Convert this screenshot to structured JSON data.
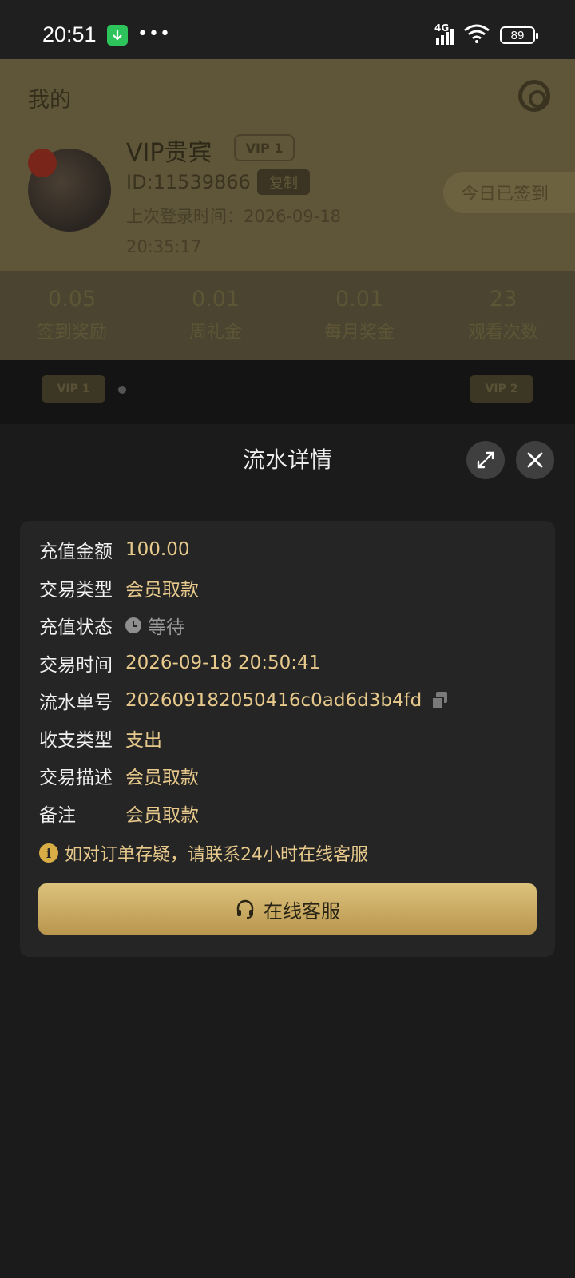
{
  "status_bar": {
    "time": "20:51",
    "network": "4G",
    "battery": "89"
  },
  "background": {
    "title": "我的",
    "username": "VIP贵宾",
    "vip_badge": "VIP 1",
    "user_id": "ID:11539866",
    "copy_tag": "复制",
    "last_login_label": "上次登录时间：",
    "last_login_value": "2026-09-18 20:35:17",
    "checkin_label": "今日已签到",
    "stats": [
      {
        "value": "0.05",
        "label": "签到奖励"
      },
      {
        "value": "0.01",
        "label": "周礼金"
      },
      {
        "value": "0.01",
        "label": "每月奖金"
      },
      {
        "value": "23",
        "label": "观看次数"
      }
    ],
    "vip_level_current": "VIP 1",
    "vip_level_next": "VIP 2"
  },
  "sheet": {
    "title": "流水详情",
    "rows": [
      {
        "label": "充值金额",
        "value": "100.00"
      },
      {
        "label": "交易类型",
        "value": "会员取款"
      },
      {
        "label": "充值状态",
        "value": "等待"
      },
      {
        "label": "交易时间",
        "value": "2026-09-18 20:50:41"
      },
      {
        "label": "流水单号",
        "value": "202609182050416c0ad6d3b4fd"
      },
      {
        "label": "收支类型",
        "value": "支出"
      },
      {
        "label": "交易描述",
        "value": "会员取款"
      },
      {
        "label": "备注",
        "value": "会员取款"
      }
    ],
    "notice": "如对订单存疑，请联系24小时在线客服",
    "cs_button_label": "在线客服"
  },
  "colors": {
    "accent_gold": "#e7c98c",
    "button_gold": "#dcc27c",
    "sheet_bg": "#1b1b1b",
    "card_bg": "#252525"
  }
}
